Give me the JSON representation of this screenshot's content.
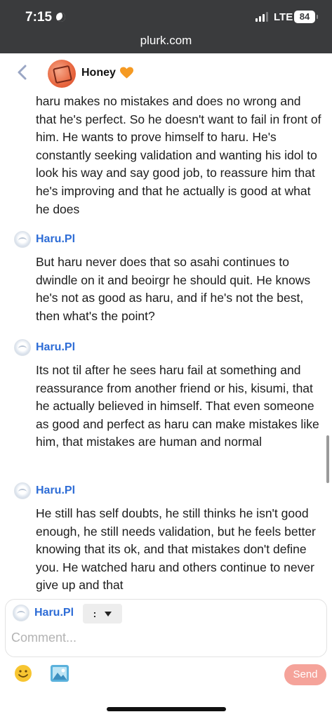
{
  "status_bar": {
    "time": "7:15",
    "network": "LTE",
    "battery": "84"
  },
  "browser": {
    "url": "plurk.com"
  },
  "header": {
    "owner_name": "Honey"
  },
  "content": {
    "intro_text": "haru makes no mistakes and does no wrong and that he's perfect. So he doesn't want to fail in front of him. He wants to prove himself to haru. He's constantly seeking validation and wanting his idol to look his way and say good job, to reassure him that he's improving and that he actually is good at what he does",
    "responses": [
      {
        "author": "Haru.Pl",
        "text": "But haru never does that so asahi continues to dwindle on it and beoirgr he should quit. He knows he's not as good as haru, and if he's not the best, then what's the point?"
      },
      {
        "author": "Haru.Pl",
        "text": "Its not til after he sees haru fail at something and reassurance from another friend or his, kisumi, that he actually believed in himself. That even someone as good and perfect as haru can make mistakes like him, that mistakes are human and normal"
      },
      {
        "author": "Haru.Pl",
        "text": "He still has self doubts, he still thinks he isn't good enough, he still needs validation, but he feels better knowing that its ok, and that mistakes don't define you. He watched haru and others continue to never give up and that"
      }
    ]
  },
  "composer": {
    "author": "Haru.Pl",
    "qualifier": ":",
    "placeholder": "Comment...",
    "send_label": "Send"
  },
  "colors": {
    "accent_name": "#2d6cd6",
    "send_button": "#f5a39a",
    "heart": "#f59a23"
  },
  "icons": [
    "back-chevron-icon",
    "moon-icon",
    "signal-icon",
    "heart-icon",
    "dropdown-triangle-icon",
    "emoji-icon",
    "image-icon"
  ]
}
